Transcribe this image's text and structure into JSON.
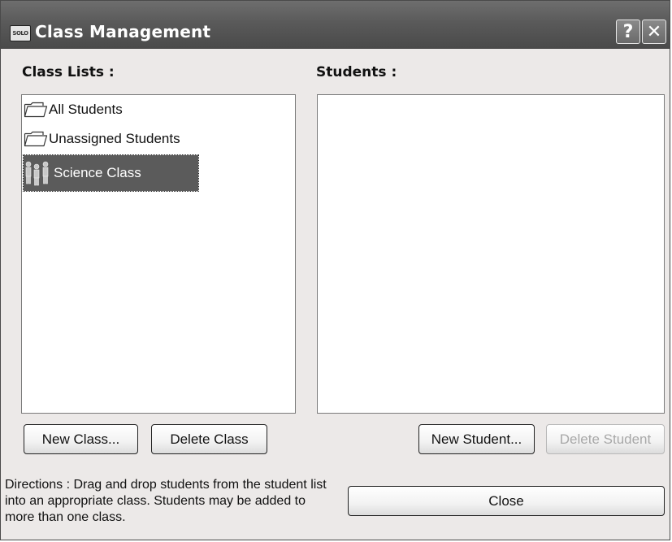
{
  "window": {
    "title": "Class Management",
    "app_icon_text": "SOLO",
    "help_glyph": "?",
    "close_glyph": "✕"
  },
  "class_panel": {
    "label": "Class Lists :",
    "items": [
      {
        "label": "All Students",
        "icon": "folder-icon",
        "selected": false
      },
      {
        "label": "Unassigned Students",
        "icon": "folder-icon",
        "selected": false
      },
      {
        "label": "Science Class",
        "icon": "class-group-icon",
        "selected": true
      }
    ]
  },
  "student_panel": {
    "label": "Students :",
    "items": []
  },
  "buttons": {
    "new_class": "New Class...",
    "delete_class": "Delete Class",
    "new_student": "New Student...",
    "delete_student": "Delete Student",
    "close": "Close"
  },
  "directions": "Directions : Drag and drop students from the student list into an appropriate class. Students may be added to more than one class.",
  "colors": {
    "titlebar": "#5a5a5a",
    "selection": "#5b5b5b",
    "dialog_bg": "#ece9e8"
  }
}
